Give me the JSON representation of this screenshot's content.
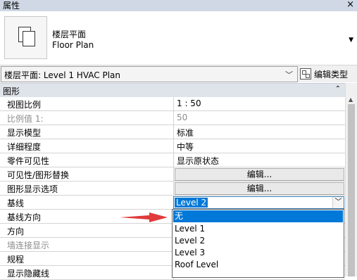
{
  "panel": {
    "title": "属性",
    "close": "×"
  },
  "type_selector": {
    "name_cn": "楼层平面",
    "name_en": "Floor Plan",
    "dropdown_arrow": "▼"
  },
  "instance": {
    "label": "楼层平面: Level 1 HVAC Plan",
    "chevron": "﹀",
    "edit_type_label": "编辑类型"
  },
  "group": {
    "title": "图形",
    "collapse_icon": "⌃"
  },
  "properties": [
    {
      "name": "视图比例",
      "value": "1 : 50",
      "disabled": false
    },
    {
      "name": "比例值 1:",
      "value": "50",
      "disabled": true
    },
    {
      "name": "显示模型",
      "value": "标准",
      "disabled": false
    },
    {
      "name": "详细程度",
      "value": "中等",
      "disabled": false
    },
    {
      "name": "零件可见性",
      "value": "显示原状态",
      "disabled": false
    },
    {
      "name": "可见性/图形替换",
      "value": "编辑...",
      "disabled": false,
      "button": true
    },
    {
      "name": "图形显示选项",
      "value": "编辑...",
      "disabled": false,
      "button": true
    },
    {
      "name": "基线",
      "value": "Level 2",
      "disabled": false
    },
    {
      "name": "基线方向",
      "value": "",
      "disabled": false
    },
    {
      "name": "方向",
      "value": "",
      "disabled": false
    },
    {
      "name": "墙连接显示",
      "value": "",
      "disabled": true
    },
    {
      "name": "规程",
      "value": "",
      "disabled": false
    },
    {
      "name": "显示隐藏线",
      "value": "",
      "disabled": false
    }
  ],
  "dropdown": {
    "selected": "Level 2",
    "options": [
      "无",
      "Level 1",
      "Level 2",
      "Level 3",
      "Roof Level"
    ],
    "highlighted_index": 0
  },
  "colors": {
    "selection": "#0078d7",
    "arrow": "#e03a3a",
    "header_bg": "#dfe3ea"
  }
}
